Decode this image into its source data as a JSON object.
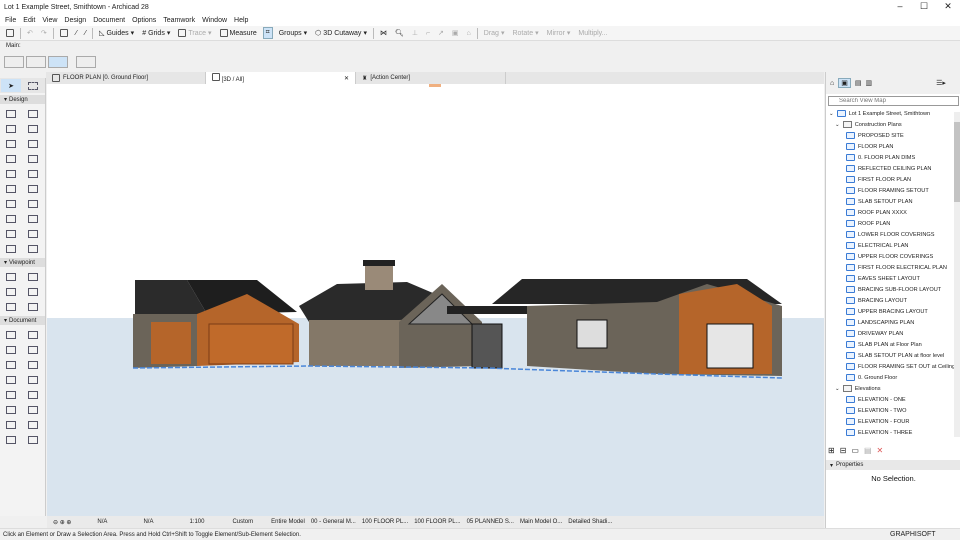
{
  "window": {
    "title": "Lot 1 Example Street, Smithtown - Archicad 28",
    "controls": [
      "minimize",
      "maximize",
      "close"
    ]
  },
  "menu": [
    "File",
    "Edit",
    "View",
    "Design",
    "Document",
    "Options",
    "Teamwork",
    "Window",
    "Help"
  ],
  "toolbar": {
    "guides": "Guides",
    "grids": "Grids",
    "trace": "Trace",
    "measure": "Measure",
    "groups": "Groups",
    "cutaway": "3D Cutaway",
    "drag": "Drag",
    "rotate": "Rotate",
    "mirror": "Mirror",
    "multiply": "Multiply..."
  },
  "main_label": "Main:",
  "tabs": [
    {
      "label": "FLOOR PLAN [0. Ground Floor]"
    },
    {
      "label": "[3D / All]",
      "active": true
    },
    {
      "label": "[Action Center]"
    }
  ],
  "toolbox": {
    "sections": [
      "Design",
      "Viewpoint",
      "Document"
    ]
  },
  "view_map": {
    "search_placeholder": "Search View Map",
    "project": "Lot 1 Example Street, Smithtown",
    "folder": "Construction Plans",
    "items": [
      "PROPOSED SITE",
      "FLOOR PLAN",
      "0. FLOOR PLAN DIMS",
      "REFLECTED CEILING PLAN",
      "FIRST FLOOR PLAN",
      "FLOOR FRAMING SETOUT",
      "SLAB SETOUT PLAN",
      "ROOF PLAN XXXX",
      "ROOF PLAN",
      "LOWER FLOOR COVERINGS",
      "ELECTRICAL PLAN",
      "UPPER FLOOR COVERINGS",
      "FIRST FLOOR ELECTRICAL PLAN",
      "EAVES SHEET LAYOUT",
      "BRACING SUB-FLOOR LAYOUT",
      "BRACING LAYOUT",
      "UPPER BRACING LAYOUT",
      "LANDSCAPING PLAN",
      "DRIVEWAY PLAN",
      "SLAB PLAN at Floor Plan",
      "SLAB SETOUT PLAN at floor level",
      "FLOOR FRAMING SET OUT at Ceiling",
      "0. Ground Floor"
    ],
    "folder2": "Elevations",
    "items2": [
      "ELEVATION - ONE",
      "ELEVATION - TWO",
      "ELEVATION - FOUR",
      "ELEVATION - THREE"
    ]
  },
  "properties": {
    "title": "Properties",
    "value": "No Selection."
  },
  "viewbar": [
    "N/A",
    "N/A",
    "1:100",
    "Custom",
    "Entire Model",
    "00 - General M...",
    "100 FLOOR PL...",
    "100 FLOOR PL...",
    "05 PLANNED S...",
    "Main Model O...",
    "Detailed Shadi..."
  ],
  "status": {
    "text": "Click an Element or Draw a Selection Area. Press and Hold Ctrl+Shift to Toggle Element/Sub-Element Selection.",
    "brand": "GRAPHISOFT"
  },
  "colors": {
    "accent": "#3a7bd5",
    "ground": "#d9e4ee",
    "roof": "#2b2b2b",
    "timber": "#b5652a",
    "wall": "#6b6459"
  }
}
